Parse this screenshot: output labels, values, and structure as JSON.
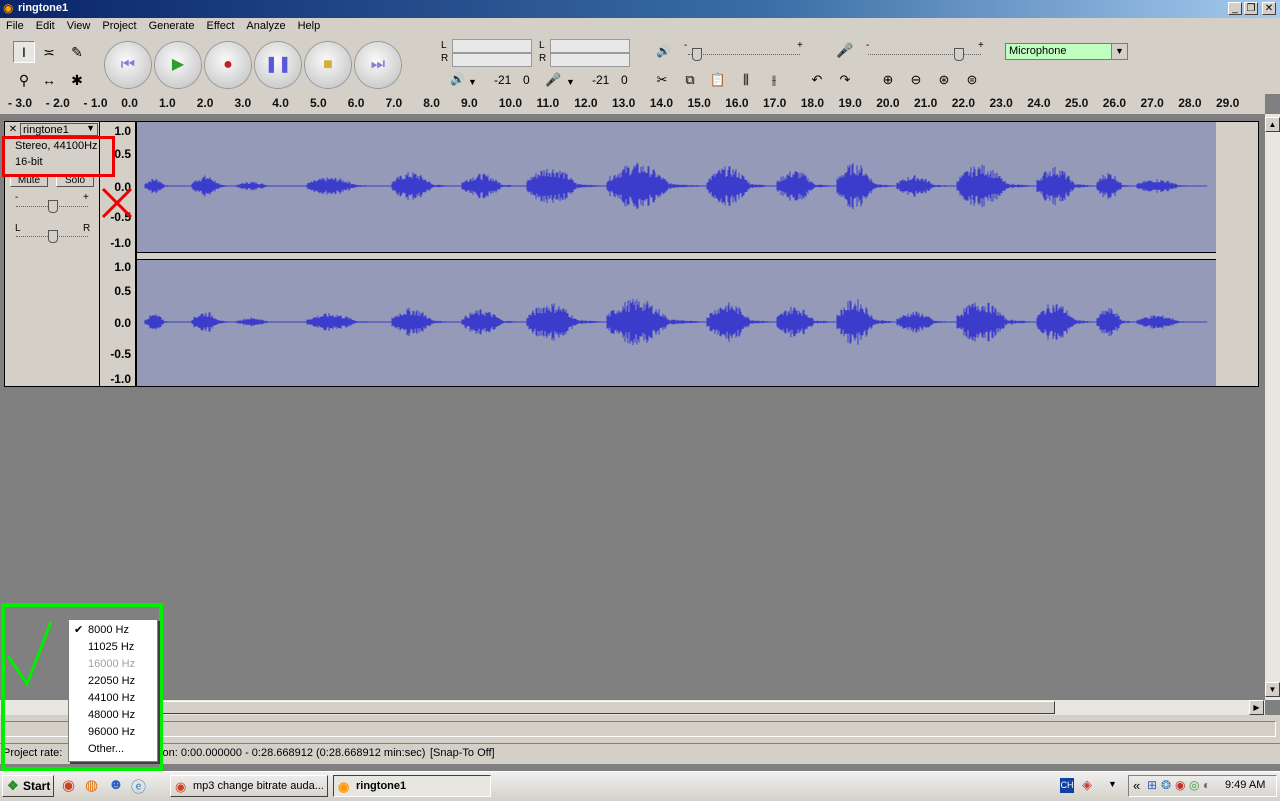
{
  "window": {
    "title": "ringtone1",
    "controls": [
      "0",
      "1",
      "r"
    ]
  },
  "menu": [
    "File",
    "Edit",
    "View",
    "Project",
    "Generate",
    "Effect",
    "Analyze",
    "Help"
  ],
  "meters": {
    "play_left": "L",
    "play_right": "R",
    "rec_left": "L",
    "rec_right": "R",
    "play_db": "-21",
    "play_zero": "0",
    "rec_db": "-21",
    "rec_zero": "0"
  },
  "mixer": {
    "output_minus": "-",
    "output_plus": "+",
    "input_minus": "-",
    "input_plus": "+"
  },
  "input_source": "Microphone",
  "ruler_ticks": [
    "- 3.0",
    "- 2.0",
    "- 1.0",
    "0.0",
    "1.0",
    "2.0",
    "3.0",
    "4.0",
    "5.0",
    "6.0",
    "7.0",
    "8.0",
    "9.0",
    "10.0",
    "11.0",
    "12.0",
    "13.0",
    "14.0",
    "15.0",
    "16.0",
    "17.0",
    "18.0",
    "19.0",
    "20.0",
    "21.0",
    "22.0",
    "23.0",
    "24.0",
    "25.0",
    "26.0",
    "27.0",
    "28.0",
    "29.0"
  ],
  "track": {
    "close": "✕",
    "name": "ringtone1",
    "format_line1": "Stereo, 44100Hz",
    "format_line2": "16-bit",
    "mute": "Mute",
    "solo": "Solo",
    "gain_minus": "-",
    "gain_plus": "+",
    "pan_left": "L",
    "pan_right": "R",
    "scale_top": [
      "1.0",
      "0.5",
      "0.0",
      "-0.5",
      "-1.0"
    ],
    "scale_bottom": [
      "1.0",
      "0.5",
      "0.0",
      "-0.5",
      "-1.0"
    ]
  },
  "status": {
    "project_rate_label": "Project rate:",
    "selection_text": "tion: 0:00.000000 - 0:28.668912 (0:28.668912 min:sec)",
    "snap": "[Snap-To Off]"
  },
  "rate_menu": {
    "items": [
      {
        "label": "8000 Hz",
        "checked": true,
        "disabled": false
      },
      {
        "label": "11025 Hz",
        "checked": false,
        "disabled": false
      },
      {
        "label": "16000 Hz",
        "checked": false,
        "disabled": true
      },
      {
        "label": "22050 Hz",
        "checked": false,
        "disabled": false
      },
      {
        "label": "44100 Hz",
        "checked": false,
        "disabled": false
      },
      {
        "label": "48000 Hz",
        "checked": false,
        "disabled": false
      },
      {
        "label": "96000 Hz",
        "checked": false,
        "disabled": false
      },
      {
        "label": "Other...",
        "checked": false,
        "disabled": false
      }
    ]
  },
  "annotations": {
    "red_color": "#ee0000",
    "green_color": "#00ee00"
  },
  "taskbar": {
    "start": "Start",
    "items": [
      "mp3 change bitrate auda...",
      "ringtone1"
    ],
    "tray_lang": "CH",
    "tray_chevron": "«",
    "clock": "9:49 AM"
  },
  "colors": {
    "waveform": "#3c3ccc",
    "wave_bg": "#949ab8",
    "mic_select": "#c0ffc0"
  }
}
